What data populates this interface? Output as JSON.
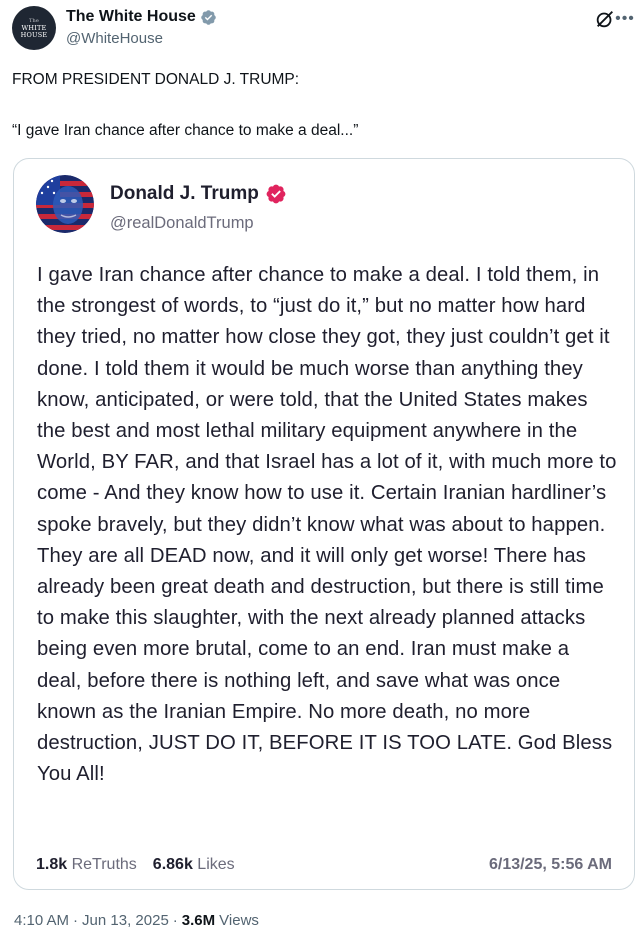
{
  "author": {
    "display_name": "The White House",
    "handle": "@WhiteHouse",
    "avatar_text_line1": "The",
    "avatar_text_line2": "WHITE",
    "avatar_text_line3": "HOUSE",
    "verified_badge": "verified-gray-icon"
  },
  "tweet": {
    "line1": "FROM PRESIDENT DONALD J. TRUMP:",
    "line2": "“I gave Iran chance after chance to make a deal...”"
  },
  "embedded_post": {
    "display_name": "Donald J. Trump",
    "handle": "@realDonaldTrump",
    "verified_badge": "verified-red-icon",
    "body": "I gave Iran chance after chance to make a deal. I told them, in the strongest of words, to “just do it,” but no matter how hard they tried, no matter how close they got, they just couldn’t get it done. I told them it would be much worse than anything they know, anticipated, or were told, that the United States makes the best and most lethal military equipment anywhere in the World, BY FAR, and that Israel has a lot of it, with much more to come - And they know how to use it. Certain Iranian hardliner’s spoke bravely, but they didn’t know what was about to happen. They are all DEAD now, and it will only get worse! There has already been great death and destruction, but there is still time to make this slaughter, with the next already planned attacks being even more brutal, come to an end. Iran must make a deal, before there is nothing left, and save what was once known as the Iranian Empire. No more death, no more destruction, JUST DO IT, BEFORE IT IS TOO LATE. God Bless You All!",
    "retruths_count": "1.8k",
    "retruths_label": "ReTruths",
    "likes_count": "6.86k",
    "likes_label": "Likes",
    "date": "6/13/25, 5:56 AM"
  },
  "footer": {
    "time": "4:10 AM",
    "separator": "·",
    "date": "Jun 13, 2025",
    "separator2": "·",
    "views_count": "3.6M",
    "views_label": "Views"
  },
  "colors": {
    "text": "#0f1419",
    "secondary": "#536471",
    "border": "#cfd9de",
    "verified_red": "#e0245e"
  }
}
